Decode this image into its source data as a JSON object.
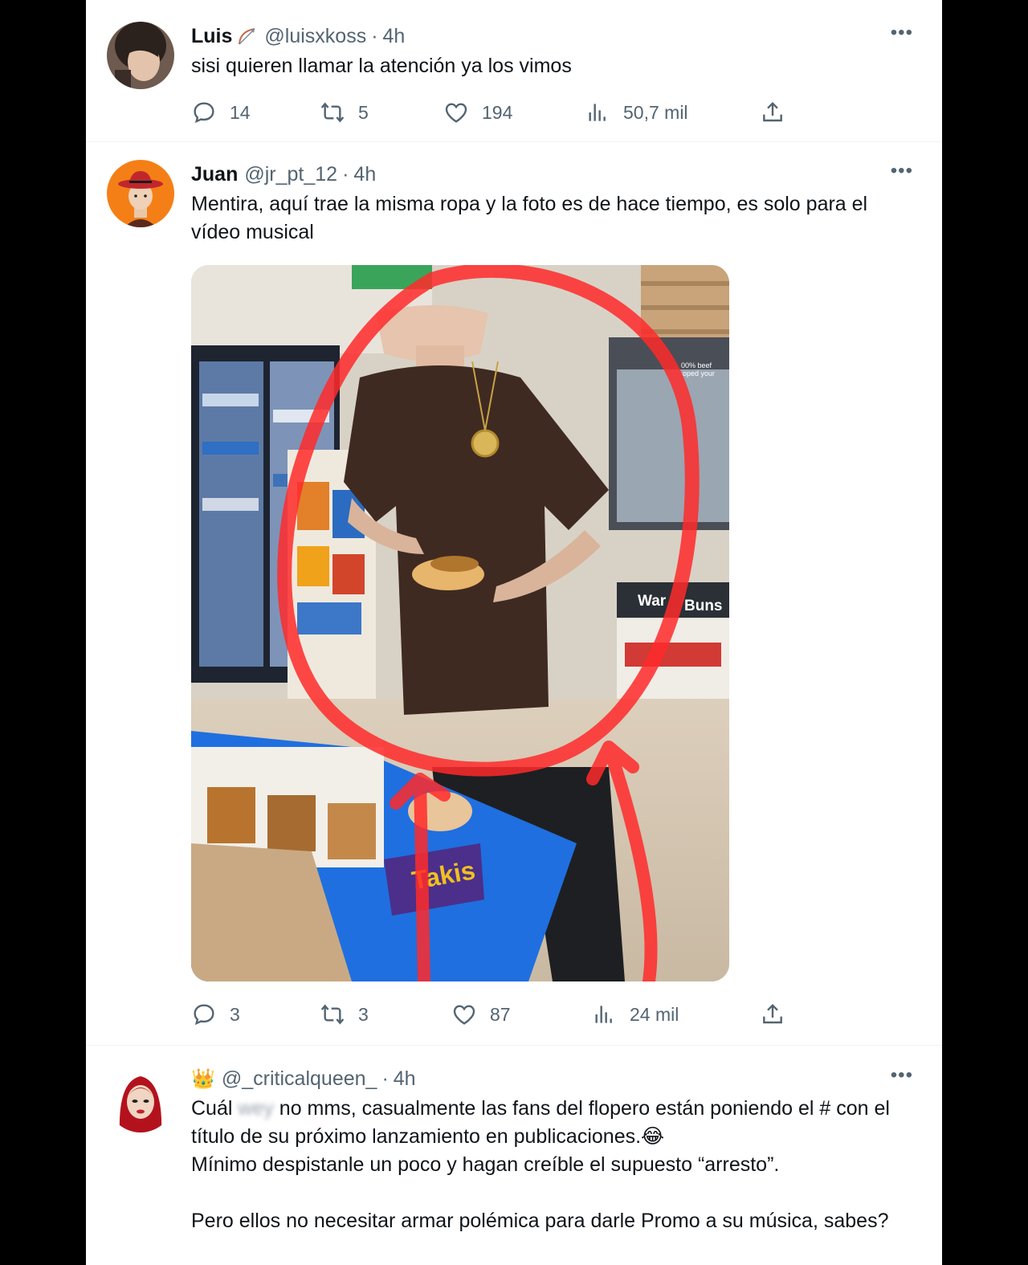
{
  "tweets": [
    {
      "name": "Luis",
      "handle": "@luisxkoss",
      "separator": "·",
      "time": "4h",
      "text": "sisi quieren llamar la atención ya los vimos",
      "replies": "14",
      "retweets": "5",
      "likes": "194",
      "views": "50,7 mil"
    },
    {
      "name": "Juan",
      "handle": "@jr_pt_12",
      "separator": "·",
      "time": "4h",
      "text": "Mentira, aquí trae la misma ropa y la foto es de hace tiempo, es solo para el vídeo musical",
      "media_labels": [
        "00% beef",
        "oped your",
        "War",
        "Buns",
        "Takis"
      ],
      "replies": "3",
      "retweets": "3",
      "likes": "87",
      "views": "24 mil"
    },
    {
      "name_emoji": "👑",
      "handle": "@_criticalqueen_",
      "separator": "·",
      "time": "4h",
      "text_before_blur": "Cuál ",
      "blurred_word": "wey",
      "text_after_blur": " no mms, casualmente las fans del flopero están poniendo el # con el título de su próximo lanzamiento en publicaciones.😂\nMínimo despistanle un poco y hagan creíble el supuesto “arresto”.\n\nPero ellos no necesitar armar polémica para darle Promo a su música, sabes?"
    }
  ],
  "icons": [
    "reply-icon",
    "retweet-icon",
    "like-icon",
    "views-icon",
    "share-icon",
    "more-icon"
  ],
  "colors": {
    "secondary_text": "#536471",
    "primary_text": "#0f1419",
    "annotation_red": "#ff2a2a"
  }
}
